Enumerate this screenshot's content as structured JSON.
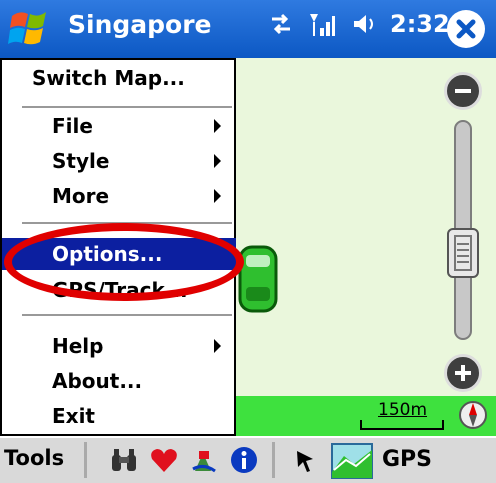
{
  "titlebar": {
    "title": "Singapore",
    "clock": "2:32",
    "icons": [
      "windows-start-icon",
      "network-sync-icon",
      "signal-icon",
      "volume-icon",
      "close-icon"
    ]
  },
  "menu": {
    "items": [
      {
        "label": "Switch Map...",
        "submenu": false
      },
      {
        "label": "File",
        "submenu": true
      },
      {
        "label": "Style",
        "submenu": true
      },
      {
        "label": "More",
        "submenu": true
      },
      {
        "label": "Options...",
        "submenu": false,
        "selected": true
      },
      {
        "label": "GPS/Track...",
        "submenu": false
      },
      {
        "label": "Help",
        "submenu": true
      },
      {
        "label": "About...",
        "submenu": false
      },
      {
        "label": "Exit",
        "submenu": false
      }
    ]
  },
  "map": {
    "scale_label": "150m",
    "background_color": "#eaf7dc",
    "strip_color": "#3ee13e"
  },
  "toolbar": {
    "tools_label": "Tools",
    "gps_label": "GPS",
    "icons": [
      "binoculars-icon",
      "heart-icon",
      "route-icon",
      "info-icon",
      "pointer-icon",
      "gps-map-icon"
    ]
  },
  "colors": {
    "titlebar": "#0c58c4",
    "menu_selected": "#0c1fa0",
    "highlight_ring": "#e00000"
  }
}
